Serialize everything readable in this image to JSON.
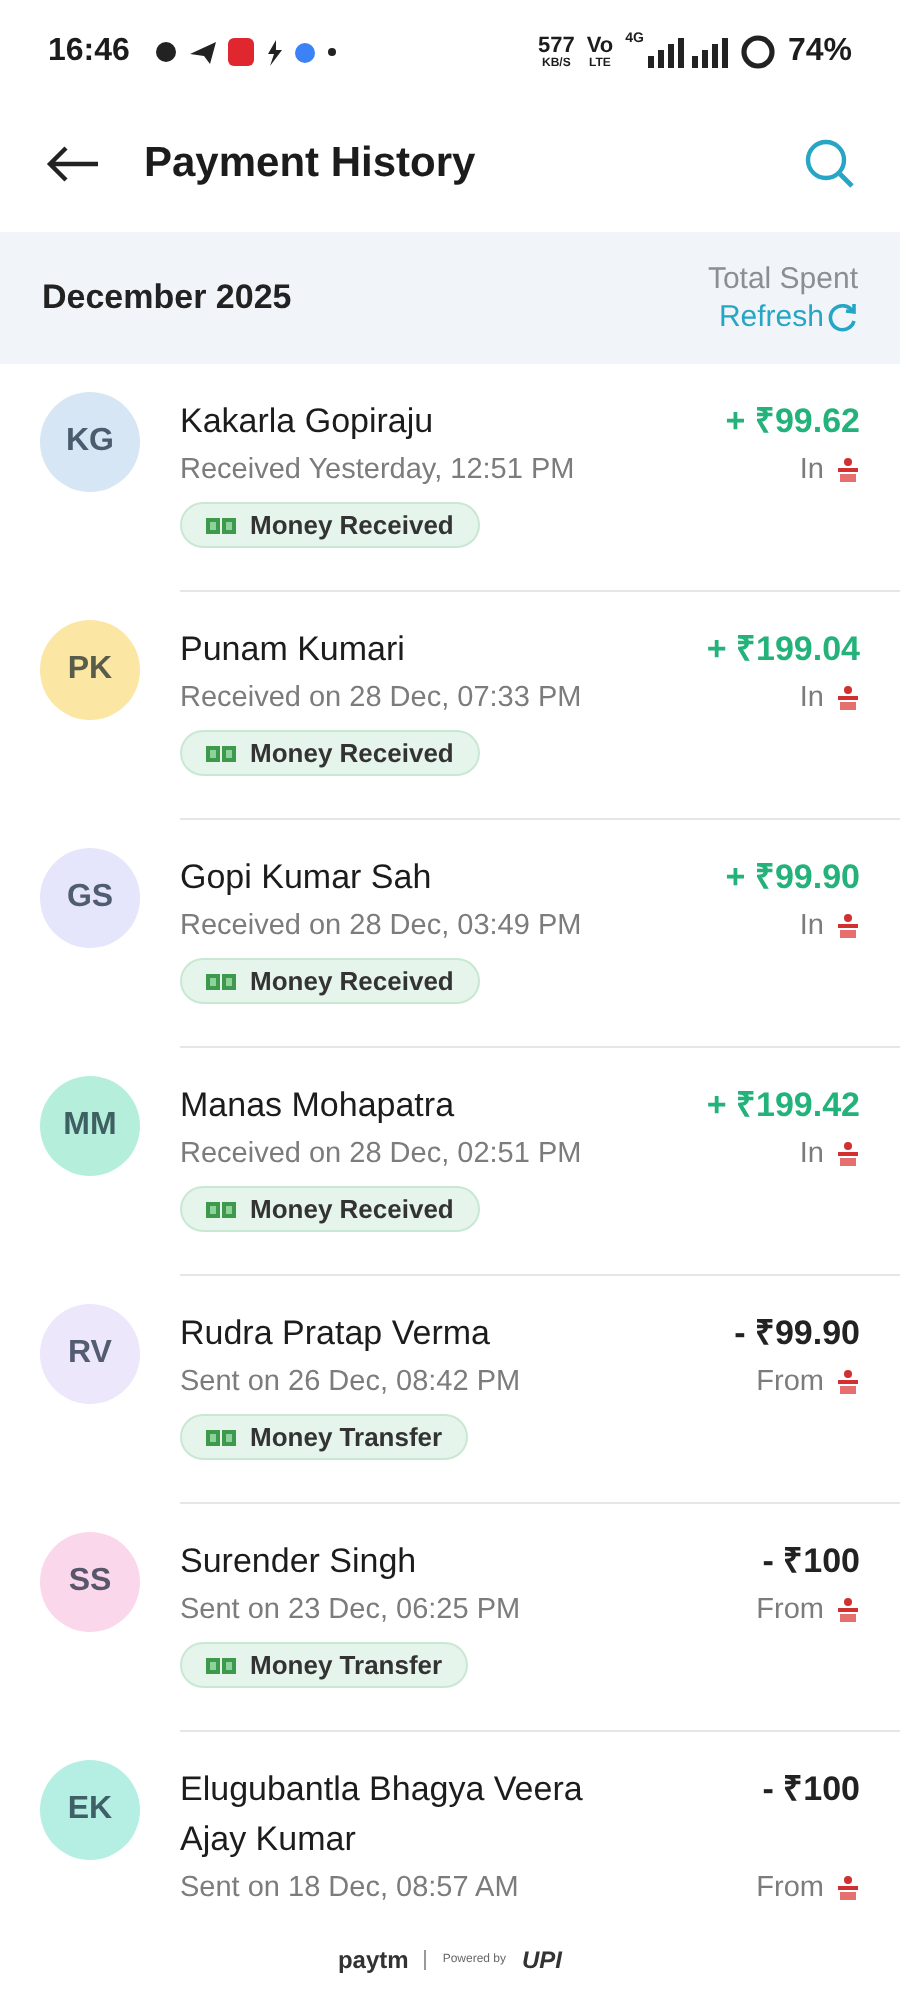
{
  "status_bar": {
    "time": "16:46",
    "net_speed": "577",
    "net_unit": "KB/S",
    "volte": "Vo",
    "lte": "LTE",
    "net_type": "4G",
    "battery": "74%"
  },
  "header": {
    "title": "Payment History"
  },
  "month_band": {
    "month": "December 2025",
    "total_label": "Total Spent",
    "refresh": "Refresh"
  },
  "transactions": [
    {
      "initials": "KG",
      "color": "#d7e6f4",
      "name": "Kakarla Gopiraju",
      "detail": "Received Yesterday, 12:51 PM",
      "tag": "Money Received",
      "amount": "+ ₹99.62",
      "kind": "in",
      "direction_label": "In"
    },
    {
      "initials": "PK",
      "color": "#fbe6a4",
      "name": "Punam Kumari",
      "detail": "Received on 28 Dec, 07:33 PM",
      "tag": "Money Received",
      "amount": "+ ₹199.04",
      "kind": "in",
      "direction_label": "In"
    },
    {
      "initials": "GS",
      "color": "#e5e6fb",
      "name": "Gopi Kumar Sah",
      "detail": "Received on 28 Dec, 03:49 PM",
      "tag": "Money Received",
      "amount": "+ ₹99.90",
      "kind": "in",
      "direction_label": "In"
    },
    {
      "initials": "MM",
      "color": "#b5efdc",
      "name": "Manas Mohapatra",
      "detail": "Received on 28 Dec, 02:51 PM",
      "tag": "Money Received",
      "amount": "+ ₹199.42",
      "kind": "in",
      "direction_label": "In"
    },
    {
      "initials": "RV",
      "color": "#ede7fb",
      "name": "Rudra Pratap Verma",
      "detail": "Sent on 26 Dec, 08:42 PM",
      "tag": "Money Transfer",
      "amount": "- ₹99.90",
      "kind": "out",
      "direction_label": "From"
    },
    {
      "initials": "SS",
      "color": "#fbd7eb",
      "name": "Surender Singh",
      "detail": "Sent on 23 Dec, 06:25 PM",
      "tag": "Money Transfer",
      "amount": "- ₹100",
      "kind": "out",
      "direction_label": "From"
    },
    {
      "initials": "EK",
      "color": "#b5efe3",
      "name": "Elugubantla Bhagya Veera Ajay Kumar",
      "detail": "Sent on 18 Dec, 08:57 AM",
      "amount": "- ₹100",
      "kind": "out",
      "direction_label": "From"
    }
  ],
  "footer": {
    "brand": "paytm",
    "powered": "Powered by",
    "upi": "UPI"
  }
}
